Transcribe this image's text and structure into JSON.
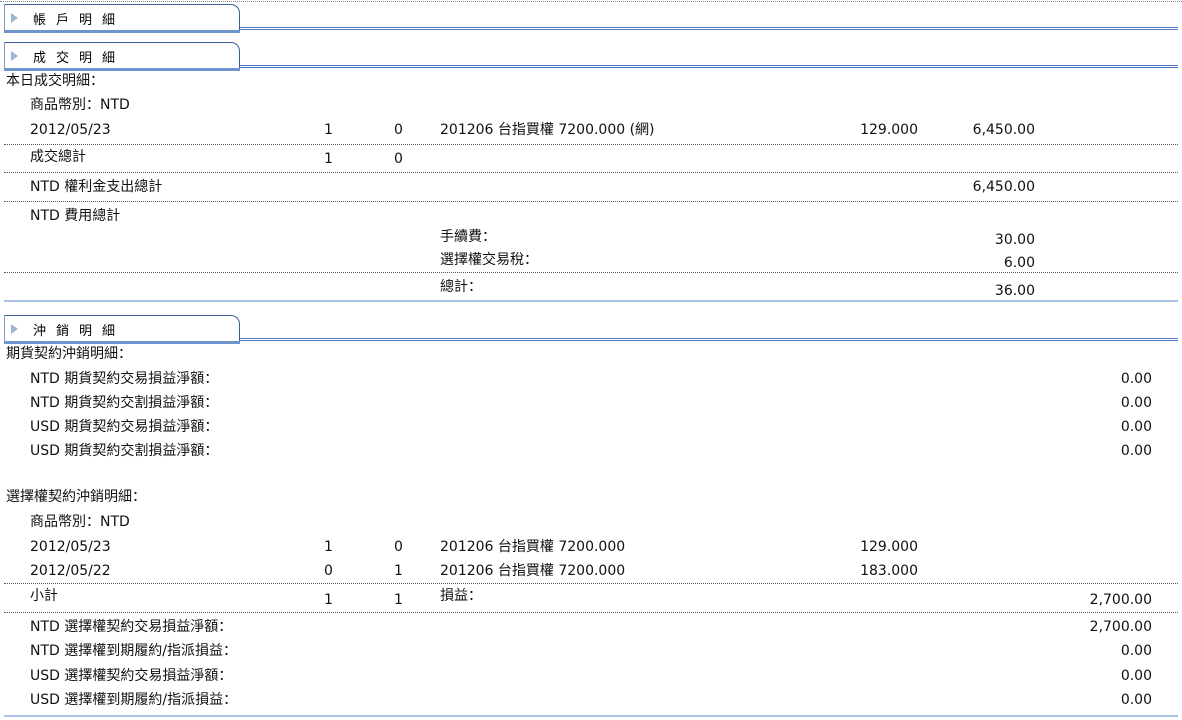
{
  "sections": {
    "account": {
      "title": "帳戶明細"
    },
    "trade": {
      "title": "成交明細"
    },
    "offset": {
      "title": "沖銷明細"
    }
  },
  "trade": {
    "today_label": "本日成交明細：",
    "currency_label": "商品幣別：NTD",
    "row": {
      "date": "2012/05/23",
      "buy": "1",
      "sell": "0",
      "product": "201206 台指買權 7200.000 (網)",
      "price": "129.000",
      "amount": "6,450.00"
    },
    "total": {
      "label": "成交總計",
      "buy": "1",
      "sell": "0"
    },
    "premium": {
      "label": "NTD 權利金支出總計",
      "amount": "6,450.00"
    },
    "fees": {
      "label": "NTD 費用總計",
      "commission_label": "手續費：",
      "commission": "30.00",
      "tax_label": "選擇權交易稅：",
      "tax": "6.00",
      "total_label": "總計：",
      "total": "36.00"
    }
  },
  "futures": {
    "label": "期貨契約沖銷明細：",
    "items": [
      {
        "label": "NTD 期貨契約交易損益淨額：",
        "value": "0.00"
      },
      {
        "label": "NTD 期貨契約交割損益淨額：",
        "value": "0.00"
      },
      {
        "label": "USD 期貨契約交易損益淨額：",
        "value": "0.00"
      },
      {
        "label": "USD 期貨契約交割損益淨額：",
        "value": "0.00"
      }
    ]
  },
  "options": {
    "label": "選擇權契約沖銷明細：",
    "currency_label": "商品幣別：NTD",
    "rows": [
      {
        "date": "2012/05/23",
        "buy": "1",
        "sell": "0",
        "product": "201206 台指買權 7200.000",
        "price": "129.000"
      },
      {
        "date": "2012/05/22",
        "buy": "0",
        "sell": "1",
        "product": "201206 台指買權 7200.000",
        "price": "183.000"
      }
    ],
    "subtotal": {
      "label": "小計",
      "buy": "1",
      "sell": "1",
      "pl_label": "損益：",
      "pl": "2,700.00"
    },
    "items": [
      {
        "label": "NTD 選擇權契約交易損益淨額：",
        "value": "2,700.00"
      },
      {
        "label": "NTD 選擇權到期履約/指派損益：",
        "value": "0.00"
      },
      {
        "label": "USD 選擇權契約交易損益淨額：",
        "value": "0.00"
      },
      {
        "label": "USD 選擇權到期履約/指派損益：",
        "value": "0.00"
      }
    ]
  }
}
